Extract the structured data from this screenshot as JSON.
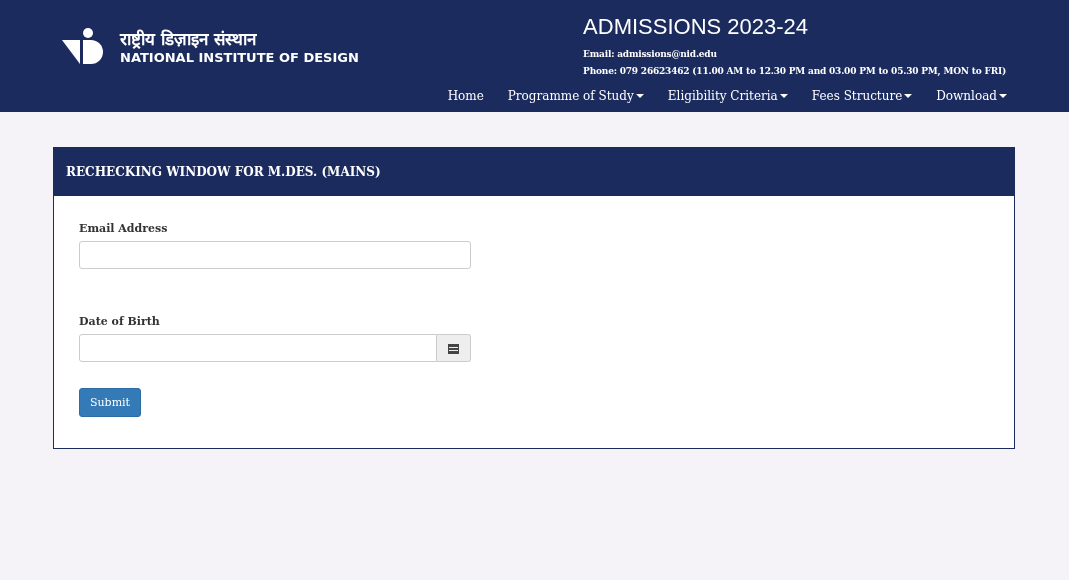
{
  "header": {
    "logo_hindi": "राष्ट्रीय डिज़ाइन संस्थान",
    "logo_english": "NATIONAL INSTITUTE OF DESIGN",
    "title": "ADMISSIONS 2023-24",
    "email": "Email: admissions@nid.edu",
    "phone": "Phone: 079 26623462 (11.00 AM to 12.30 PM and 03.00 PM to 05.30 PM, MON to FRI)"
  },
  "nav": [
    {
      "label": "Home",
      "has_dropdown": false
    },
    {
      "label": "Programme of Study",
      "has_dropdown": true
    },
    {
      "label": "Eligibility Criteria",
      "has_dropdown": true
    },
    {
      "label": "Fees Structure",
      "has_dropdown": true
    },
    {
      "label": "Download",
      "has_dropdown": true
    }
  ],
  "panel": {
    "title": "RECHECKING WINDOW FOR M.DES. (MAINS)",
    "fields": [
      {
        "label": "Email Address",
        "kind": "text"
      },
      {
        "label": "Date of Birth",
        "kind": "date"
      }
    ],
    "submit": "Submit"
  }
}
